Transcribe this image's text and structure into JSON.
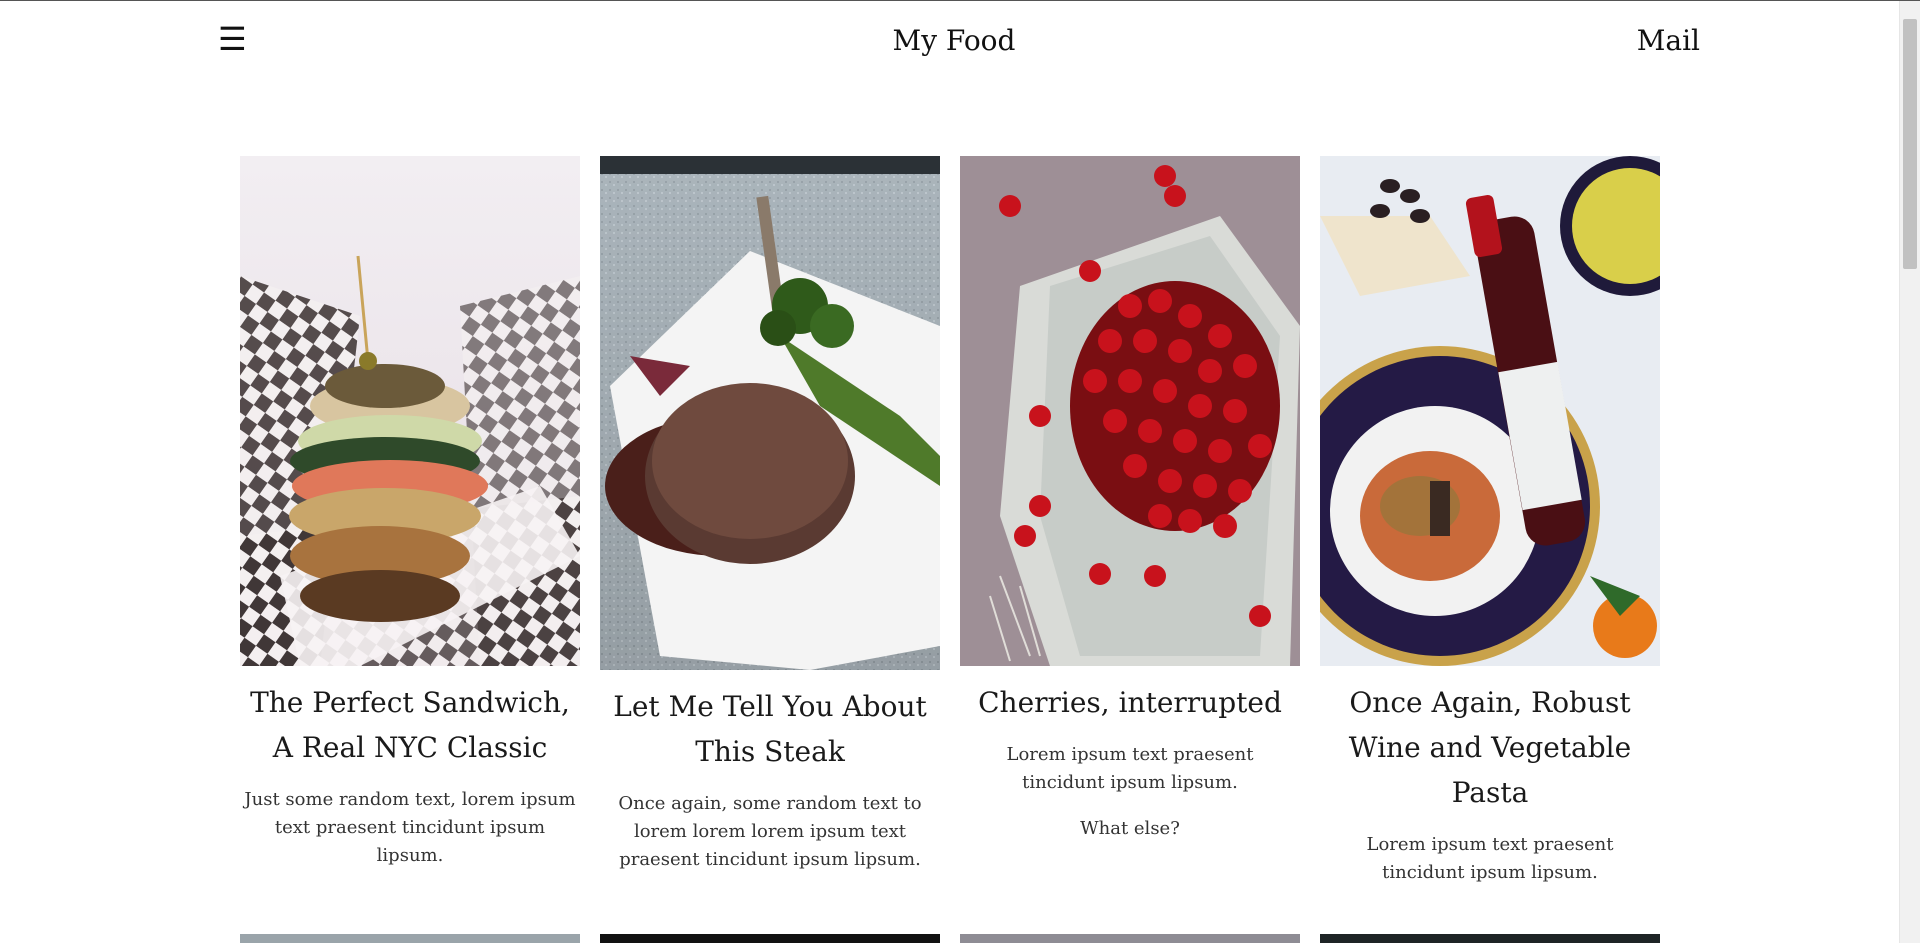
{
  "header": {
    "menu_icon": "☰",
    "brand": "My Food",
    "mail_label": "Mail"
  },
  "cards": [
    {
      "title": "The Perfect Sandwich, A Real NYC Classic",
      "text": "Just some random text, lorem ipsum text praesent tincidunt ipsum lipsum.",
      "image": "sandwich-photo"
    },
    {
      "title": "Let Me Tell You About This Steak",
      "text": "Once again, some random text to lorem lorem lorem ipsum text praesent tincidunt ipsum lipsum.",
      "image": "steak-photo"
    },
    {
      "title": "Cherries, interrupted",
      "text": "Lorem ipsum text praesent tincidunt ipsum lipsum.",
      "text2": "What else?",
      "image": "cherries-photo"
    },
    {
      "title": "Once Again, Robust Wine and Vegetable Pasta",
      "text": "Lorem ipsum text praesent tincidunt ipsum lipsum.",
      "image": "wine-pasta-photo"
    }
  ],
  "colors": {
    "background": "#ffffff",
    "text": "#1a1a1a"
  }
}
